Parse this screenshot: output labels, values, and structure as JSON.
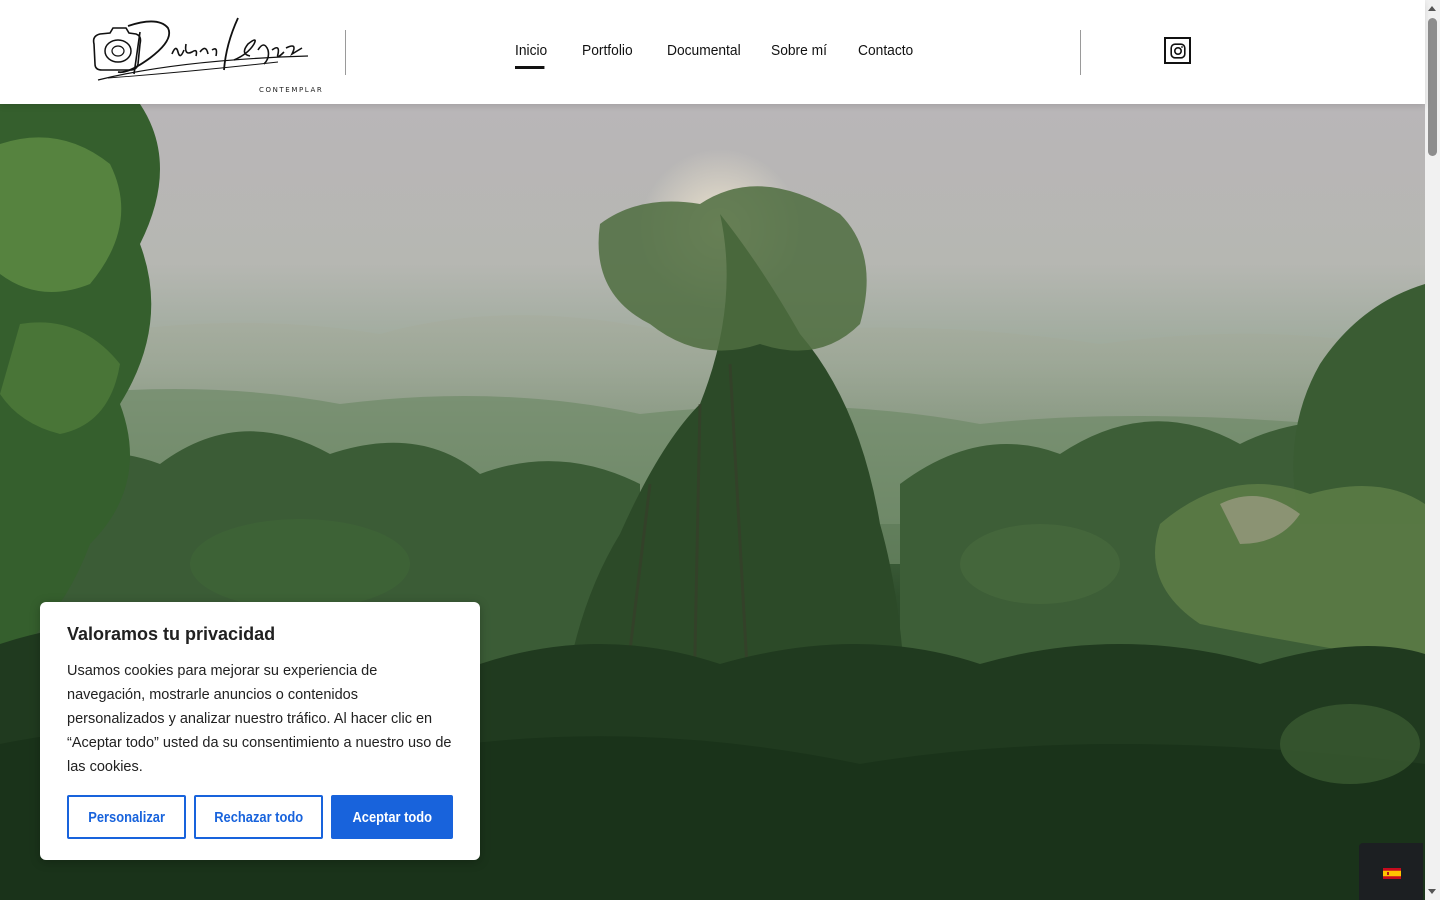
{
  "header": {
    "logo_text": "Dídac López",
    "logo_subtitle": "CONTEMPLAR",
    "nav": [
      {
        "label": "Inicio",
        "active": true
      },
      {
        "label": "Portfolio",
        "active": false
      },
      {
        "label": "Documental",
        "active": false
      },
      {
        "label": "Sobre mí",
        "active": false
      },
      {
        "label": "Contacto",
        "active": false
      }
    ],
    "social_icon": "instagram-icon"
  },
  "hero": {
    "image": "misty-forest-canopy"
  },
  "cookie": {
    "title": "Valoramos tu privacidad",
    "text": "Usamos cookies para mejorar su experiencia de navegación, mostrarle anuncios o contenidos personalizados y analizar nuestro tráfico. Al hacer clic en “Aceptar todo” usted da su consentimiento a nuestro uso de las cookies.",
    "customize_label": "Personalizar",
    "reject_label": "Rechazar todo",
    "accept_label": "Aceptar todo",
    "accent_color": "#1863dc"
  },
  "language": {
    "flag": "spain-flag-icon"
  }
}
